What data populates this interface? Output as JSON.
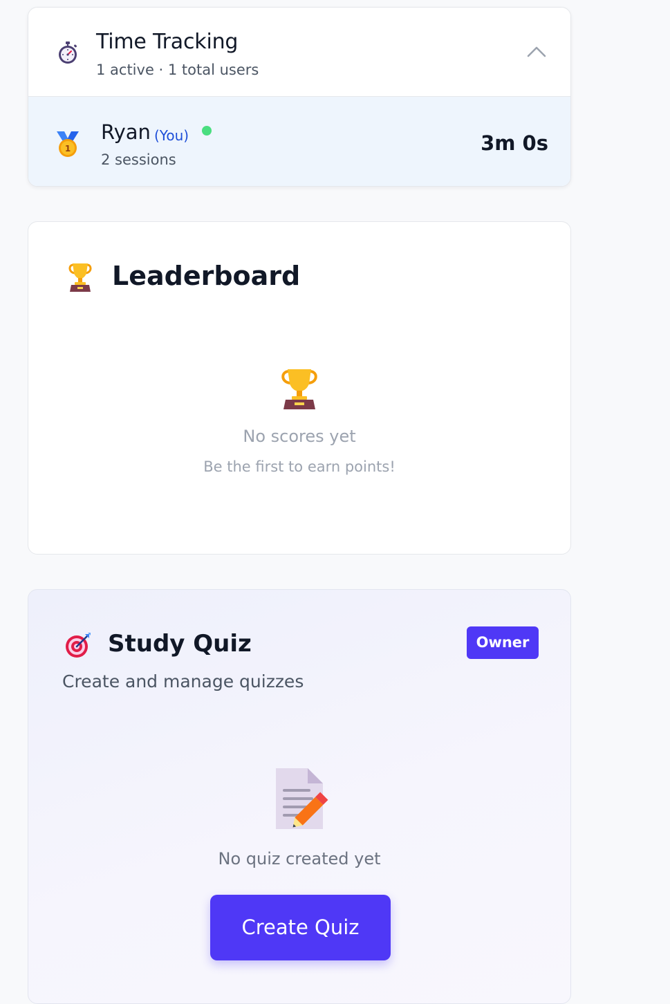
{
  "time_tracking": {
    "icon": "stopwatch-icon",
    "title": "Time Tracking",
    "subtitle": "1 active · 1 total users",
    "collapse_icon": "chevron-up-icon",
    "users": [
      {
        "rank_icon": "gold-medal-icon",
        "rank": "1",
        "name": "Ryan",
        "you_label": "(You)",
        "online": true,
        "sessions": "2 sessions",
        "time": "3m 0s"
      }
    ]
  },
  "leaderboard": {
    "icon": "trophy-icon",
    "title": "Leaderboard",
    "empty_icon": "trophy-icon",
    "empty_title": "No scores yet",
    "empty_subtitle": "Be the first to earn points!"
  },
  "study_quiz": {
    "icon": "target-icon",
    "title": "Study Quiz",
    "badge": "Owner",
    "subtitle": "Create and manage quizzes",
    "empty_icon": "memo-pencil-icon",
    "empty_text": "No quiz created yet",
    "create_button": "Create Quiz"
  },
  "colors": {
    "accent": "#4f38f6",
    "you_label": "#1d4ed8",
    "online": "#4ade80",
    "row_highlight": "#eef5fd"
  }
}
